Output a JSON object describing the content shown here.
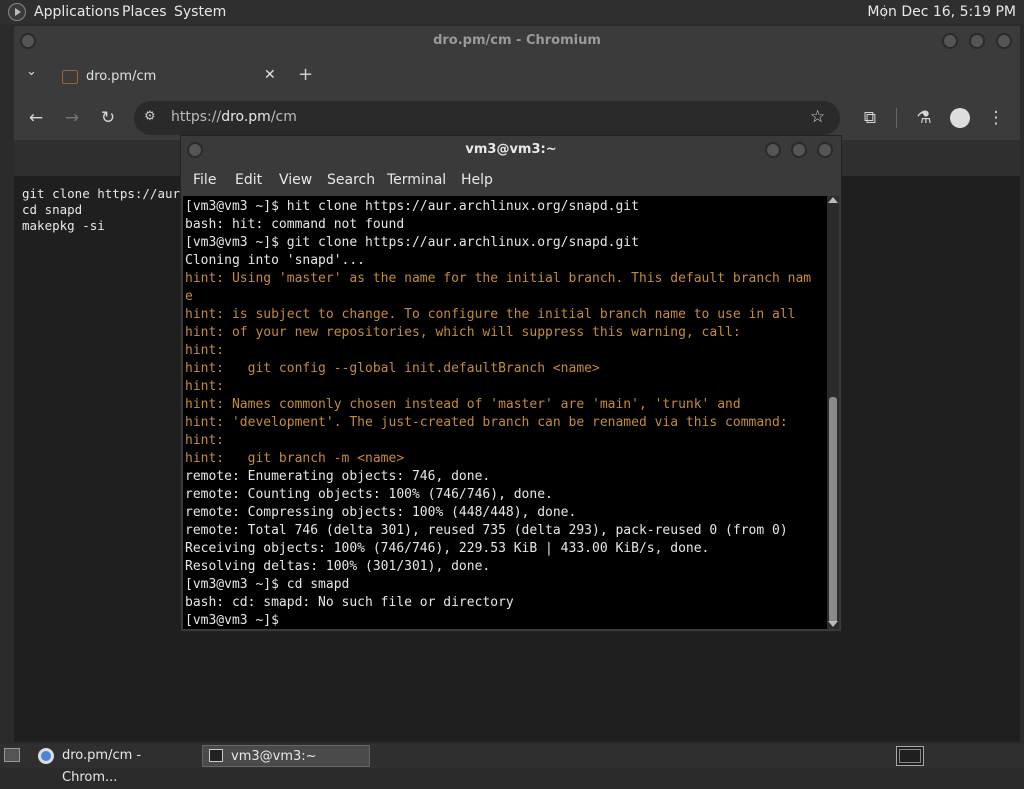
{
  "topbar": {
    "menus": [
      "Applications",
      "Places",
      "System"
    ],
    "clock": "Mon Dec 16,  5:19 PM"
  },
  "chromium": {
    "window_title": "dro.pm/cm - Chromium",
    "tab_title": "dro.pm/cm",
    "url_scheme": "https://",
    "url_host": "dro.pm",
    "url_path": "/cm",
    "page_text": "git clone https://aur\ncd snapd\nmakepkg -si"
  },
  "terminal": {
    "title": "vm3@vm3:~",
    "menu": [
      "File",
      "Edit",
      "View",
      "Search",
      "Terminal",
      "Help"
    ],
    "lines": [
      {
        "t": "out",
        "s": "[vm3@vm3 ~]$ hit clone https://aur.archlinux.org/snapd.git"
      },
      {
        "t": "out",
        "s": "bash: hit: command not found"
      },
      {
        "t": "out",
        "s": "[vm3@vm3 ~]$ git clone https://aur.archlinux.org/snapd.git"
      },
      {
        "t": "out",
        "s": "Cloning into 'snapd'..."
      },
      {
        "t": "hint",
        "s": "hint: Using 'master' as the name for the initial branch. This default branch nam"
      },
      {
        "t": "hint",
        "s": "e"
      },
      {
        "t": "hint",
        "s": "hint: is subject to change. To configure the initial branch name to use in all"
      },
      {
        "t": "hint",
        "s": "hint: of your new repositories, which will suppress this warning, call:"
      },
      {
        "t": "hint",
        "s": "hint:"
      },
      {
        "t": "hint",
        "s": "hint:   git config --global init.defaultBranch <name>"
      },
      {
        "t": "hint",
        "s": "hint:"
      },
      {
        "t": "hint",
        "s": "hint: Names commonly chosen instead of 'master' are 'main', 'trunk' and"
      },
      {
        "t": "hint",
        "s": "hint: 'development'. The just-created branch can be renamed via this command:"
      },
      {
        "t": "hint",
        "s": "hint:"
      },
      {
        "t": "hint",
        "s": "hint:   git branch -m <name>"
      },
      {
        "t": "out",
        "s": "remote: Enumerating objects: 746, done."
      },
      {
        "t": "out",
        "s": "remote: Counting objects: 100% (746/746), done."
      },
      {
        "t": "out",
        "s": "remote: Compressing objects: 100% (448/448), done."
      },
      {
        "t": "out",
        "s": "remote: Total 746 (delta 301), reused 735 (delta 293), pack-reused 0 (from 0)"
      },
      {
        "t": "out",
        "s": "Receiving objects: 100% (746/746), 229.53 KiB | 433.00 KiB/s, done."
      },
      {
        "t": "out",
        "s": "Resolving deltas: 100% (301/301), done."
      },
      {
        "t": "out",
        "s": "[vm3@vm3 ~]$ cd smapd"
      },
      {
        "t": "out",
        "s": "bash: cd: smapd: No such file or directory"
      },
      {
        "t": "out",
        "s": "[vm3@vm3 ~]$ "
      }
    ]
  },
  "taskbar": {
    "tasks": [
      "dro.pm/cm - Chrom...",
      "vm3@vm3:~"
    ]
  },
  "colors": {
    "hint": "#c38b3a",
    "terminal_bg": "#000000",
    "text": "#e6e6e6"
  }
}
